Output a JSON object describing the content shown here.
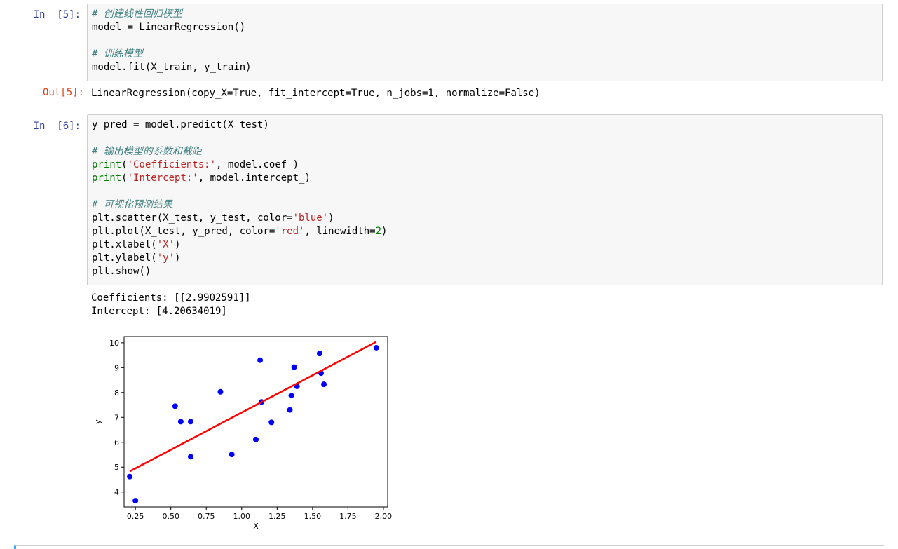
{
  "cell5": {
    "in_prompt": "In  [5]:",
    "out_prompt": "Out[5]:",
    "code": {
      "l1": "# 创建线性回归模型",
      "l2": "model = LinearRegression()",
      "l3": "# 训练模型",
      "l4": "model.fit(X_train, y_train)"
    },
    "output": "LinearRegression(copy_X=True, fit_intercept=True, n_jobs=1, normalize=False)"
  },
  "cell6": {
    "in_prompt": "In  [6]:",
    "code": {
      "l1": "y_pred = model.predict(X_test)",
      "c1": "# 输出模型的系数和截距",
      "p1_fn": "print",
      "p1_str": "'Coefficients:'",
      "p1_rest": ", model.coef_)",
      "p2_fn": "print",
      "p2_str": "'Intercept:'",
      "p2_rest": ", model.intercept_)",
      "c2": "# 可视化预测结果",
      "s1_a": "plt.scatter(X_test, y_test, color=",
      "s1_str": "'blue'",
      "s2_a": "plt.plot(X_test, y_pred, color=",
      "s2_str": "'red'",
      "s2_b": ", linewidth=",
      "s2_num": "2",
      "x_a": "plt.xlabel(",
      "x_str": "'X'",
      "y_a": "plt.ylabel(",
      "y_str": "'y'",
      "show": "plt.show()"
    },
    "stream": {
      "coef": "Coefficients: [[2.9902591]]",
      "intercept": "Intercept: [4.20634019]"
    }
  },
  "chart_data": {
    "type": "scatter",
    "xlabel": "X",
    "ylabel": "y",
    "xlim": [
      0.17,
      2.03
    ],
    "ylim": [
      3.4,
      10.25
    ],
    "xticks": [
      "0.25",
      "0.50",
      "0.75",
      "1.00",
      "1.25",
      "1.50",
      "1.75",
      "2.00"
    ],
    "yticks": [
      "4",
      "5",
      "6",
      "7",
      "8",
      "9",
      "10"
    ],
    "grid": false,
    "series": [
      {
        "kind": "scatter",
        "color": "#0000ff",
        "points": [
          [
            0.21,
            4.62
          ],
          [
            0.25,
            3.65
          ],
          [
            0.53,
            7.45
          ],
          [
            0.57,
            6.83
          ],
          [
            0.64,
            6.83
          ],
          [
            0.64,
            5.42
          ],
          [
            0.85,
            8.03
          ],
          [
            0.93,
            5.51
          ],
          [
            1.1,
            6.11
          ],
          [
            1.13,
            9.3
          ],
          [
            1.14,
            7.62
          ],
          [
            1.21,
            6.8
          ],
          [
            1.34,
            7.3
          ],
          [
            1.35,
            7.88
          ],
          [
            1.37,
            9.02
          ],
          [
            1.39,
            8.25
          ],
          [
            1.55,
            9.57
          ],
          [
            1.56,
            8.78
          ],
          [
            1.58,
            8.33
          ],
          [
            1.95,
            9.8
          ]
        ]
      },
      {
        "kind": "line",
        "color": "#ff0000",
        "points": [
          [
            0.21,
            4.83
          ],
          [
            1.95,
            10.04
          ]
        ]
      }
    ]
  }
}
